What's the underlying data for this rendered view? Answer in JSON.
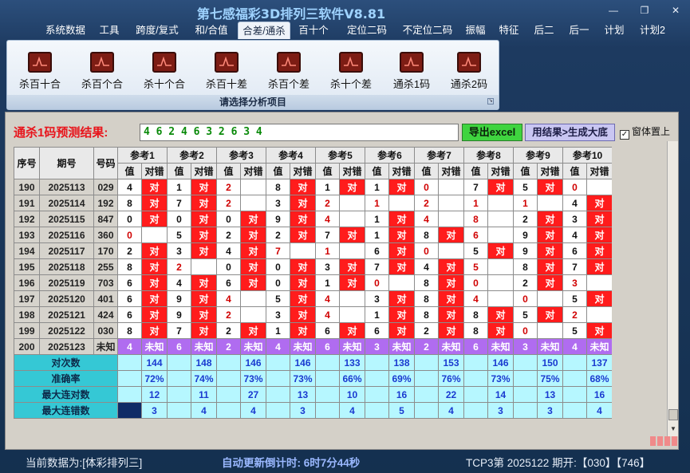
{
  "window": {
    "title": "第七感福彩3D排列三软件V8.81",
    "min_icon": "minimize-icon",
    "max_icon": "restore-icon",
    "close_icon": "close-icon"
  },
  "menu": [
    {
      "label": "系统数据"
    },
    {
      "label": "工具"
    },
    {
      "label": "跨度/复式"
    },
    {
      "label": "和/合值"
    },
    {
      "label": "合差/通杀",
      "active": true
    },
    {
      "label": "百十个"
    },
    {
      "label": "定位二码"
    },
    {
      "label": "不定位二码"
    },
    {
      "label": "振幅"
    },
    {
      "label": "特征"
    },
    {
      "label": "后二"
    },
    {
      "label": "后一"
    },
    {
      "label": "计划"
    },
    {
      "label": "计划2"
    }
  ],
  "ribbon": {
    "items": [
      {
        "label": "杀百十合",
        "icon": "chart-icon"
      },
      {
        "label": "杀百个合",
        "icon": "chart-icon"
      },
      {
        "label": "杀十个合",
        "icon": "chart-icon"
      },
      {
        "label": "杀百十差",
        "icon": "chart-icon"
      },
      {
        "label": "杀百个差",
        "icon": "chart-icon"
      },
      {
        "label": "杀十个差",
        "icon": "chart-icon"
      },
      {
        "label": "通杀1码",
        "icon": "chart-icon"
      },
      {
        "label": "通杀2码",
        "icon": "chart-icon"
      }
    ],
    "caption": "请选择分析项目"
  },
  "result": {
    "label": "通杀1码预测结果:",
    "value": "4 6 2 4 6 3 2 6 3 4",
    "export_label": "导出excel",
    "generate_label": "用结果>生成大底",
    "ontop_label": "窗体置上",
    "ontop_checked": true
  },
  "table": {
    "headers": {
      "seq": "序号",
      "period": "期号",
      "number": "号码",
      "val": "值",
      "hit": "对错",
      "refs": [
        "参考1",
        "参考2",
        "参考3",
        "参考4",
        "参考5",
        "参考6",
        "参考7",
        "参考8",
        "参考9",
        "参考10"
      ]
    },
    "hit_text": "对",
    "rows": [
      {
        "seq": "190",
        "period": "2025113",
        "number": "029",
        "cells": [
          [
            "4",
            1
          ],
          [
            "1",
            1
          ],
          [
            "2",
            0
          ],
          [
            "8",
            1
          ],
          [
            "1",
            1
          ],
          [
            "1",
            1
          ],
          [
            "0",
            0
          ],
          [
            "7",
            1
          ],
          [
            "5",
            1
          ],
          [
            "0",
            0
          ]
        ]
      },
      {
        "seq": "191",
        "period": "2025114",
        "number": "192",
        "cells": [
          [
            "8",
            1
          ],
          [
            "7",
            1
          ],
          [
            "2",
            0
          ],
          [
            "3",
            1
          ],
          [
            "2",
            0
          ],
          [
            "1",
            0
          ],
          [
            "2",
            0
          ],
          [
            "1",
            0
          ],
          [
            "1",
            0
          ],
          [
            "4",
            1
          ]
        ]
      },
      {
        "seq": "192",
        "period": "2025115",
        "number": "847",
        "cells": [
          [
            "0",
            1
          ],
          [
            "0",
            1
          ],
          [
            "0",
            1
          ],
          [
            "9",
            1
          ],
          [
            "4",
            0
          ],
          [
            "1",
            1
          ],
          [
            "4",
            0
          ],
          [
            "8",
            0
          ],
          [
            "2",
            1
          ],
          [
            "3",
            1
          ]
        ]
      },
      {
        "seq": "193",
        "period": "2025116",
        "number": "360",
        "cells": [
          [
            "0",
            0
          ],
          [
            "5",
            1
          ],
          [
            "2",
            1
          ],
          [
            "2",
            1
          ],
          [
            "7",
            1
          ],
          [
            "1",
            1
          ],
          [
            "8",
            1
          ],
          [
            "6",
            0
          ],
          [
            "9",
            1
          ],
          [
            "4",
            1
          ]
        ]
      },
      {
        "seq": "194",
        "period": "2025117",
        "number": "170",
        "cells": [
          [
            "2",
            1
          ],
          [
            "3",
            1
          ],
          [
            "4",
            1
          ],
          [
            "7",
            0
          ],
          [
            "1",
            0
          ],
          [
            "6",
            1
          ],
          [
            "0",
            0
          ],
          [
            "5",
            1
          ],
          [
            "9",
            1
          ],
          [
            "6",
            1
          ]
        ]
      },
      {
        "seq": "195",
        "period": "2025118",
        "number": "255",
        "cells": [
          [
            "8",
            1
          ],
          [
            "2",
            0
          ],
          [
            "0",
            1
          ],
          [
            "0",
            1
          ],
          [
            "3",
            1
          ],
          [
            "7",
            1
          ],
          [
            "4",
            1
          ],
          [
            "5",
            0
          ],
          [
            "8",
            1
          ],
          [
            "7",
            1
          ]
        ]
      },
      {
        "seq": "196",
        "period": "2025119",
        "number": "703",
        "cells": [
          [
            "6",
            1
          ],
          [
            "4",
            1
          ],
          [
            "6",
            1
          ],
          [
            "0",
            1
          ],
          [
            "1",
            1
          ],
          [
            "0",
            0
          ],
          [
            "8",
            1
          ],
          [
            "0",
            0
          ],
          [
            "2",
            1
          ],
          [
            "3",
            0
          ]
        ]
      },
      {
        "seq": "197",
        "period": "2025120",
        "number": "401",
        "cells": [
          [
            "6",
            1
          ],
          [
            "9",
            1
          ],
          [
            "4",
            0
          ],
          [
            "5",
            1
          ],
          [
            "4",
            0
          ],
          [
            "3",
            1
          ],
          [
            "8",
            1
          ],
          [
            "4",
            0
          ],
          [
            "0",
            0
          ],
          [
            "5",
            1
          ]
        ]
      },
      {
        "seq": "198",
        "period": "2025121",
        "number": "424",
        "cells": [
          [
            "6",
            1
          ],
          [
            "9",
            1
          ],
          [
            "2",
            0
          ],
          [
            "3",
            1
          ],
          [
            "4",
            0
          ],
          [
            "1",
            1
          ],
          [
            "8",
            1
          ],
          [
            "8",
            1
          ],
          [
            "5",
            1
          ],
          [
            "2",
            0
          ]
        ]
      },
      {
        "seq": "199",
        "period": "2025122",
        "number": "030",
        "cells": [
          [
            "8",
            1
          ],
          [
            "7",
            1
          ],
          [
            "2",
            1
          ],
          [
            "1",
            1
          ],
          [
            "6",
            1
          ],
          [
            "6",
            1
          ],
          [
            "2",
            1
          ],
          [
            "8",
            1
          ],
          [
            "0",
            0
          ],
          [
            "5",
            1
          ]
        ]
      }
    ],
    "predict": {
      "seq": "200",
      "period": "2025123",
      "number": "未知",
      "values": [
        "4",
        "6",
        "2",
        "4",
        "6",
        "3",
        "2",
        "6",
        "3",
        "4"
      ],
      "unknown": "未知"
    },
    "stats": [
      {
        "label": "对次数",
        "values": [
          "144",
          "148",
          "146",
          "146",
          "133",
          "138",
          "153",
          "146",
          "150",
          "137"
        ]
      },
      {
        "label": "准确率",
        "values": [
          "72%",
          "74%",
          "73%",
          "73%",
          "66%",
          "69%",
          "76%",
          "73%",
          "75%",
          "68%"
        ]
      },
      {
        "label": "最大连对数",
        "values": [
          "12",
          "11",
          "27",
          "13",
          "10",
          "16",
          "22",
          "14",
          "13",
          "16"
        ]
      },
      {
        "label": "最大连错数",
        "values": [
          "3",
          "4",
          "4",
          "3",
          "4",
          "5",
          "4",
          "3",
          "3",
          "4"
        ]
      }
    ]
  },
  "status": {
    "data_source": "当前数据为:[体彩排列三]",
    "countdown": "自动更新倒计时: 6时7分44秒",
    "draw_info": "TCP3第 2025122 期开:【030】【746】"
  }
}
